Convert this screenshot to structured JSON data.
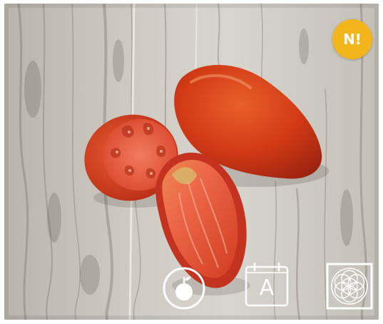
{
  "badge": {
    "label": "N!",
    "color": "#f2b51b"
  },
  "actions": {
    "fruit": {
      "icon": "tomato-fruit-icon"
    },
    "calendar": {
      "icon": "calendar-icon",
      "letter": "A"
    },
    "flower": {
      "icon": "flower-of-life-icon"
    }
  },
  "photo": {
    "subject_icon": "sliced-heirloom-tomato-on-wood"
  }
}
